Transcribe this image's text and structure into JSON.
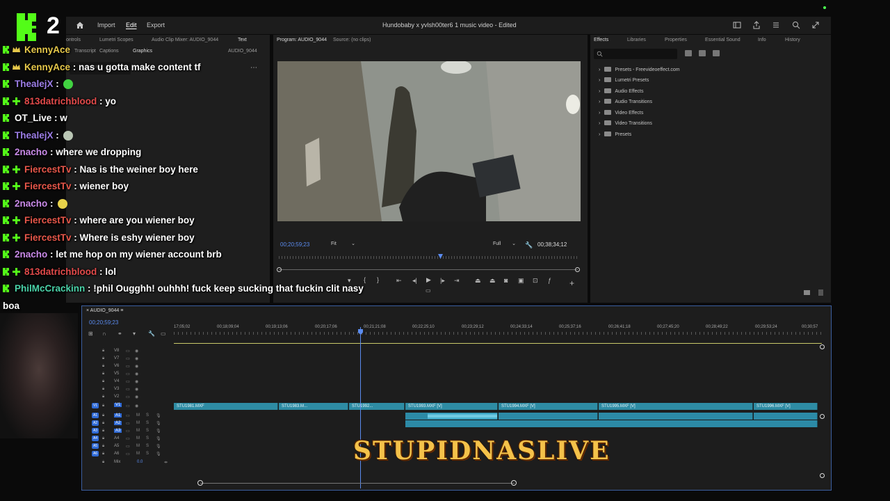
{
  "menu": {
    "import": "Import",
    "edit": "Edit",
    "export": "Export",
    "document_title": "Hundobaby x yvlsh00ter6 1 music video - Edited"
  },
  "kick_overlay": {
    "logo_number": "2"
  },
  "source_panel": {
    "tabs": [
      "ontrols",
      "Lumetri Scopes",
      "Audio Clip Mixer: AUDIO_9044",
      "Text"
    ],
    "subtabs": [
      "Transcript",
      "Captions",
      "Graphics"
    ],
    "active_subtab": "Graphics",
    "sequence_name": "AUDIO_9044",
    "search_placeholder": "Search"
  },
  "program_monitor": {
    "tab_program": "Program: AUDIO_9044",
    "tab_source": "Source: (no clips)",
    "current_tc": "00;20;59;23",
    "fit": "Fit",
    "quality": "Full",
    "duration_tc": "00;38;34;12"
  },
  "effects_panel": {
    "tabs": [
      "Effects",
      "Libraries",
      "Properties",
      "Essential Sound",
      "Info",
      "History"
    ],
    "items": [
      "Presets - Freevideoeffect.com",
      "Lumetri Presets",
      "Audio Effects",
      "Audio Transitions",
      "Video Effects",
      "Video Transitions",
      "Presets"
    ]
  },
  "timeline": {
    "sequence_name": "AUDIO_9044",
    "current_tc": "00;20;59;23",
    "ruler_ticks": [
      "17;05;02",
      "00;18;09;04",
      "00;19;13;06",
      "00;20;17;06",
      "00;21;21;08",
      "00;22;25;10",
      "00;23;29;12",
      "00;24;33;14",
      "00;25;37;16",
      "00;26;41;18",
      "00;27;45;20",
      "00;28;49;22",
      "00;29;53;24",
      "00;30;57"
    ],
    "video_tracks": [
      "V8",
      "V7",
      "V6",
      "V5",
      "V4",
      "V3",
      "V2",
      "V1"
    ],
    "audio_tracks": [
      "A1",
      "A2",
      "A3",
      "A4",
      "A5",
      "A6"
    ],
    "mix_label": "Mix",
    "mix_value": "0.0",
    "clips": [
      "STU1981.MXF",
      "STU1983.M...",
      "STU1992...",
      "STU1993.MXF [V]",
      "STU1994.MXF [V]",
      "STU1995.MXF [V]",
      "STU1996.MXF [V]"
    ]
  },
  "stream_overlay_text": "STUPIDNASLIVE",
  "chat": [
    {
      "user": "KennyAce",
      "color": "#e6c84a",
      "text": "",
      "badges": [
        "k",
        "crown"
      ]
    },
    {
      "user": "KennyAce",
      "color": "#e6c84a",
      "text": ": nas u gotta make content tf",
      "badges": [
        "k",
        "crown"
      ]
    },
    {
      "user": "ThealejX",
      "color": "#9d7ee8",
      "text": ":",
      "badges": [
        "k"
      ],
      "emote": "#41d241"
    },
    {
      "user": "813datrichblood",
      "color": "#e24a4a",
      "text": ": yo",
      "badges": [
        "k",
        "plus"
      ]
    },
    {
      "user": "OT_Live",
      "color": "#ffffff",
      "text": ": w",
      "badges": [
        "k"
      ]
    },
    {
      "user": "ThealejX",
      "color": "#9d7ee8",
      "text": ":",
      "badges": [
        "k"
      ],
      "emote": "#b9c6b4"
    },
    {
      "user": "2nacho",
      "color": "#c98ae8",
      "text": ": where we dropping",
      "badges": [
        "k"
      ]
    },
    {
      "user": "FiercestTv",
      "color": "#e8574a",
      "text": ": Nas is the weiner boy here",
      "badges": [
        "k",
        "plus"
      ]
    },
    {
      "user": "FiercestTv",
      "color": "#e8574a",
      "text": ": wiener boy",
      "badges": [
        "k",
        "plus"
      ]
    },
    {
      "user": "2nacho",
      "color": "#c98ae8",
      "text": ":",
      "badges": [
        "k"
      ],
      "emote": "#e8d24a"
    },
    {
      "user": "FiercestTv",
      "color": "#e8574a",
      "text": ": where are you wiener boy",
      "badges": [
        "k",
        "plus"
      ]
    },
    {
      "user": "FiercestTv",
      "color": "#e8574a",
      "text": ": Where is eshy wiener boy",
      "badges": [
        "k",
        "plus"
      ]
    },
    {
      "user": "2nacho",
      "color": "#c98ae8",
      "text": ": let me hop on my wiener account brb",
      "badges": [
        "k"
      ]
    },
    {
      "user": "813datrichblood",
      "color": "#e24a4a",
      "text": ": lol",
      "badges": [
        "k",
        "plus"
      ]
    },
    {
      "user": "PhilMcCrackinn",
      "color": "#4ad2a8",
      "text": ": !phil Ougghh! ouhhh! fuck keep sucking that fuckin clit nasy",
      "badges": [
        "k"
      ]
    },
    {
      "user": "",
      "color": "#ffffff",
      "text": "boa",
      "badges": []
    }
  ]
}
